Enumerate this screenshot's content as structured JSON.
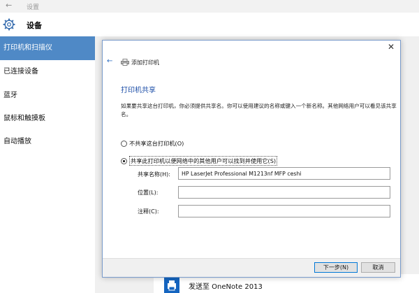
{
  "settings": {
    "titlebar": {
      "back_icon": "←",
      "title": "设置"
    },
    "header": {
      "title": "设备",
      "icon": "gear-icon"
    },
    "nav": {
      "items": [
        {
          "label": "打印机和扫描仪",
          "active": true
        },
        {
          "label": "已连接设备"
        },
        {
          "label": "蓝牙"
        },
        {
          "label": "鼠标和触摸板"
        },
        {
          "label": "自动播放"
        }
      ]
    },
    "content": {
      "onenote_label": "发送至 OneNote 2013"
    }
  },
  "dialog": {
    "close_icon": "✕",
    "back_icon": "←",
    "wizard_title": "添加打印机",
    "section_title": "打印机共享",
    "description": "如果要共享这台打印机，你必须提供共享名。你可以使用建议的名称或键入一个新名称。其他网络用户可以看见该共享名。",
    "options": {
      "no_share": "不共享这台打印机(O)",
      "share": "共享此打印机以便网络中的其他用户可以找到并使用它(S)"
    },
    "fields": {
      "share_name_label": "共享名称(H):",
      "share_name_value": "HP LaserJet Professional M1213nf MFP ceshi",
      "location_label": "位置(L):",
      "location_value": "",
      "comment_label": "注释(C):",
      "comment_value": ""
    },
    "buttons": {
      "next": "下一步(N)",
      "cancel": "取消"
    }
  },
  "colors": {
    "accent": "#4f89c6",
    "title_blue": "#1e4fa8",
    "link_blue": "#2a6cc0"
  }
}
